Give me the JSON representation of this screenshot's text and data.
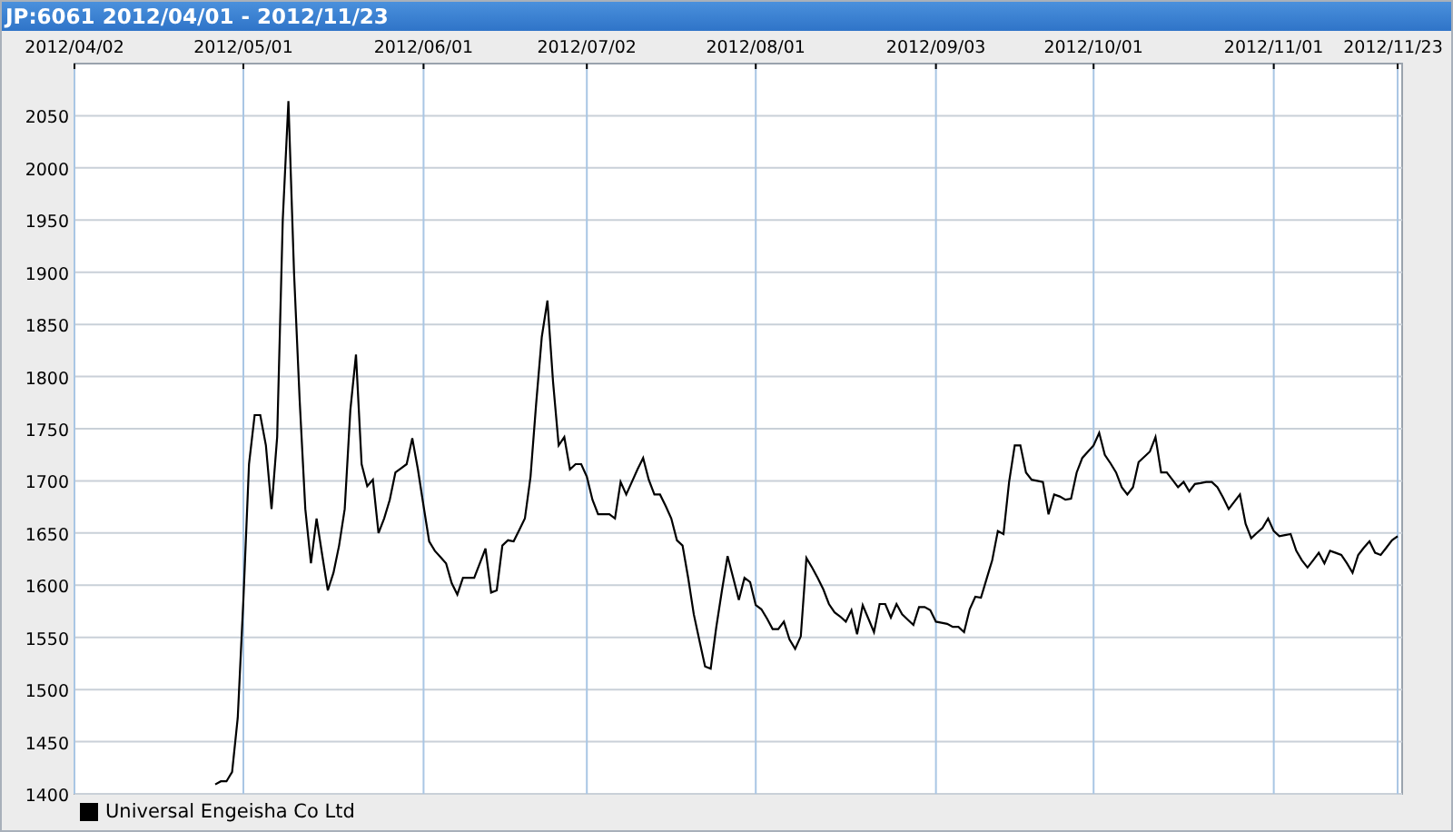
{
  "window": {
    "title": "JP:6061 2012/04/01 - 2012/11/23"
  },
  "chart_data": {
    "type": "line",
    "grid": true,
    "ylim": [
      1400,
      2100
    ],
    "yticks": [
      1400,
      1450,
      1500,
      1550,
      1600,
      1650,
      1700,
      1750,
      1800,
      1850,
      1900,
      1950,
      2000,
      2050
    ],
    "categories": [
      "2012/04/02",
      null,
      null,
      null,
      null,
      null,
      null,
      null,
      null,
      null,
      null,
      null,
      null,
      null,
      null,
      null,
      null,
      null,
      null,
      null,
      null,
      null,
      null,
      null,
      null,
      null,
      null,
      null,
      null,
      null,
      "2012/05/01",
      null,
      null,
      null,
      null,
      null,
      null,
      null,
      null,
      null,
      null,
      null,
      null,
      null,
      null,
      null,
      null,
      null,
      null,
      null,
      null,
      null,
      null,
      null,
      null,
      null,
      null,
      null,
      null,
      null,
      null,
      null,
      "2012/06/01",
      null,
      null,
      null,
      null,
      null,
      null,
      null,
      null,
      null,
      null,
      null,
      null,
      null,
      null,
      null,
      null,
      null,
      null,
      null,
      null,
      null,
      null,
      null,
      null,
      null,
      null,
      null,
      null,
      "2012/07/02",
      null,
      null,
      null,
      null,
      null,
      null,
      null,
      null,
      null,
      null,
      null,
      null,
      null,
      null,
      null,
      null,
      null,
      null,
      null,
      null,
      null,
      null,
      null,
      null,
      null,
      null,
      null,
      null,
      null,
      "2012/08/01",
      null,
      null,
      null,
      null,
      null,
      null,
      null,
      null,
      null,
      null,
      null,
      null,
      null,
      null,
      null,
      null,
      null,
      null,
      null,
      null,
      null,
      null,
      null,
      null,
      null,
      null,
      null,
      null,
      null,
      null,
      null,
      "2012/09/03",
      null,
      null,
      null,
      null,
      null,
      null,
      null,
      null,
      null,
      null,
      null,
      null,
      null,
      null,
      null,
      null,
      null,
      null,
      null,
      null,
      null,
      null,
      null,
      null,
      null,
      null,
      null,
      "2012/10/01",
      null,
      null,
      null,
      null,
      null,
      null,
      null,
      null,
      null,
      null,
      null,
      null,
      null,
      null,
      null,
      null,
      null,
      null,
      null,
      null,
      null,
      null,
      null,
      null,
      null,
      null,
      null,
      null,
      null,
      null,
      null,
      "2012/11/01",
      null,
      null,
      null,
      null,
      null,
      null,
      null,
      null,
      null,
      null,
      null,
      null,
      null,
      null,
      null,
      null,
      null,
      null,
      null,
      null,
      null,
      "2012/11/23"
    ],
    "series": [
      {
        "name": "Universal Engeisha Co Ltd",
        "color": "#000000",
        "values": [
          null,
          null,
          null,
          null,
          null,
          null,
          null,
          null,
          null,
          null,
          null,
          null,
          null,
          null,
          null,
          null,
          null,
          null,
          null,
          null,
          null,
          null,
          null,
          null,
          null,
          1409,
          1412,
          1412,
          1421,
          1473,
          1586,
          1716,
          1763,
          1763,
          1734,
          1673,
          1742,
          1951,
          2064,
          1899,
          1777,
          1673,
          1621,
          1664,
          1629,
          1595,
          1612,
          1638,
          1673,
          1768,
          1821,
          1716,
          1695,
          1701,
          1650,
          1664,
          1682,
          1708,
          1712,
          1716,
          1741,
          1711,
          1676,
          1642,
          1633,
          1627,
          1621,
          1602,
          1591,
          1607,
          1607,
          1607,
          1621,
          1635,
          1593,
          1595,
          1638,
          1643,
          1642,
          1653,
          1664,
          1704,
          1774,
          1838,
          1873,
          1795,
          1734,
          1742,
          1711,
          1716,
          1716,
          1704,
          1682,
          1668,
          1668,
          1668,
          1664,
          1699,
          1687,
          1699,
          1711,
          1722,
          1701,
          1687,
          1687,
          1676,
          1664,
          1643,
          1638,
          1607,
          1572,
          1547,
          1522,
          1520,
          1560,
          1595,
          1628,
          1607,
          1586,
          1607,
          1603,
          1581,
          1577,
          1568,
          1558,
          1558,
          1565,
          1548,
          1539,
          1551,
          1626,
          1617,
          1607,
          1596,
          1582,
          1574,
          1570,
          1565,
          1576,
          1553,
          1581,
          1568,
          1555,
          1582,
          1582,
          1569,
          1582,
          1572,
          1567,
          1562,
          1579,
          1579,
          1576,
          1565,
          1564,
          1563,
          1560,
          1560,
          1555,
          1577,
          1589,
          1588,
          1606,
          1624,
          1652,
          1649,
          1699,
          1734,
          1734,
          1708,
          1701,
          1700,
          1699,
          1668,
          1687,
          1685,
          1682,
          1683,
          1708,
          1722,
          1728,
          1734,
          1746,
          1725,
          1717,
          1708,
          1694,
          1687,
          1694,
          1718,
          1723,
          1728,
          1742,
          1708,
          1708,
          1701,
          1694,
          1699,
          1690,
          1697,
          1698,
          1699,
          1699,
          1694,
          1684,
          1673,
          1680,
          1687,
          1659,
          1645,
          1650,
          1655,
          1664,
          1652,
          1647,
          1648,
          1649,
          1633,
          1624,
          1617,
          1624,
          1631,
          1621,
          1633,
          1631,
          1629,
          1621,
          1612,
          1629,
          1636,
          1642,
          1631,
          1629,
          1636,
          1643,
          1647
        ]
      }
    ]
  }
}
